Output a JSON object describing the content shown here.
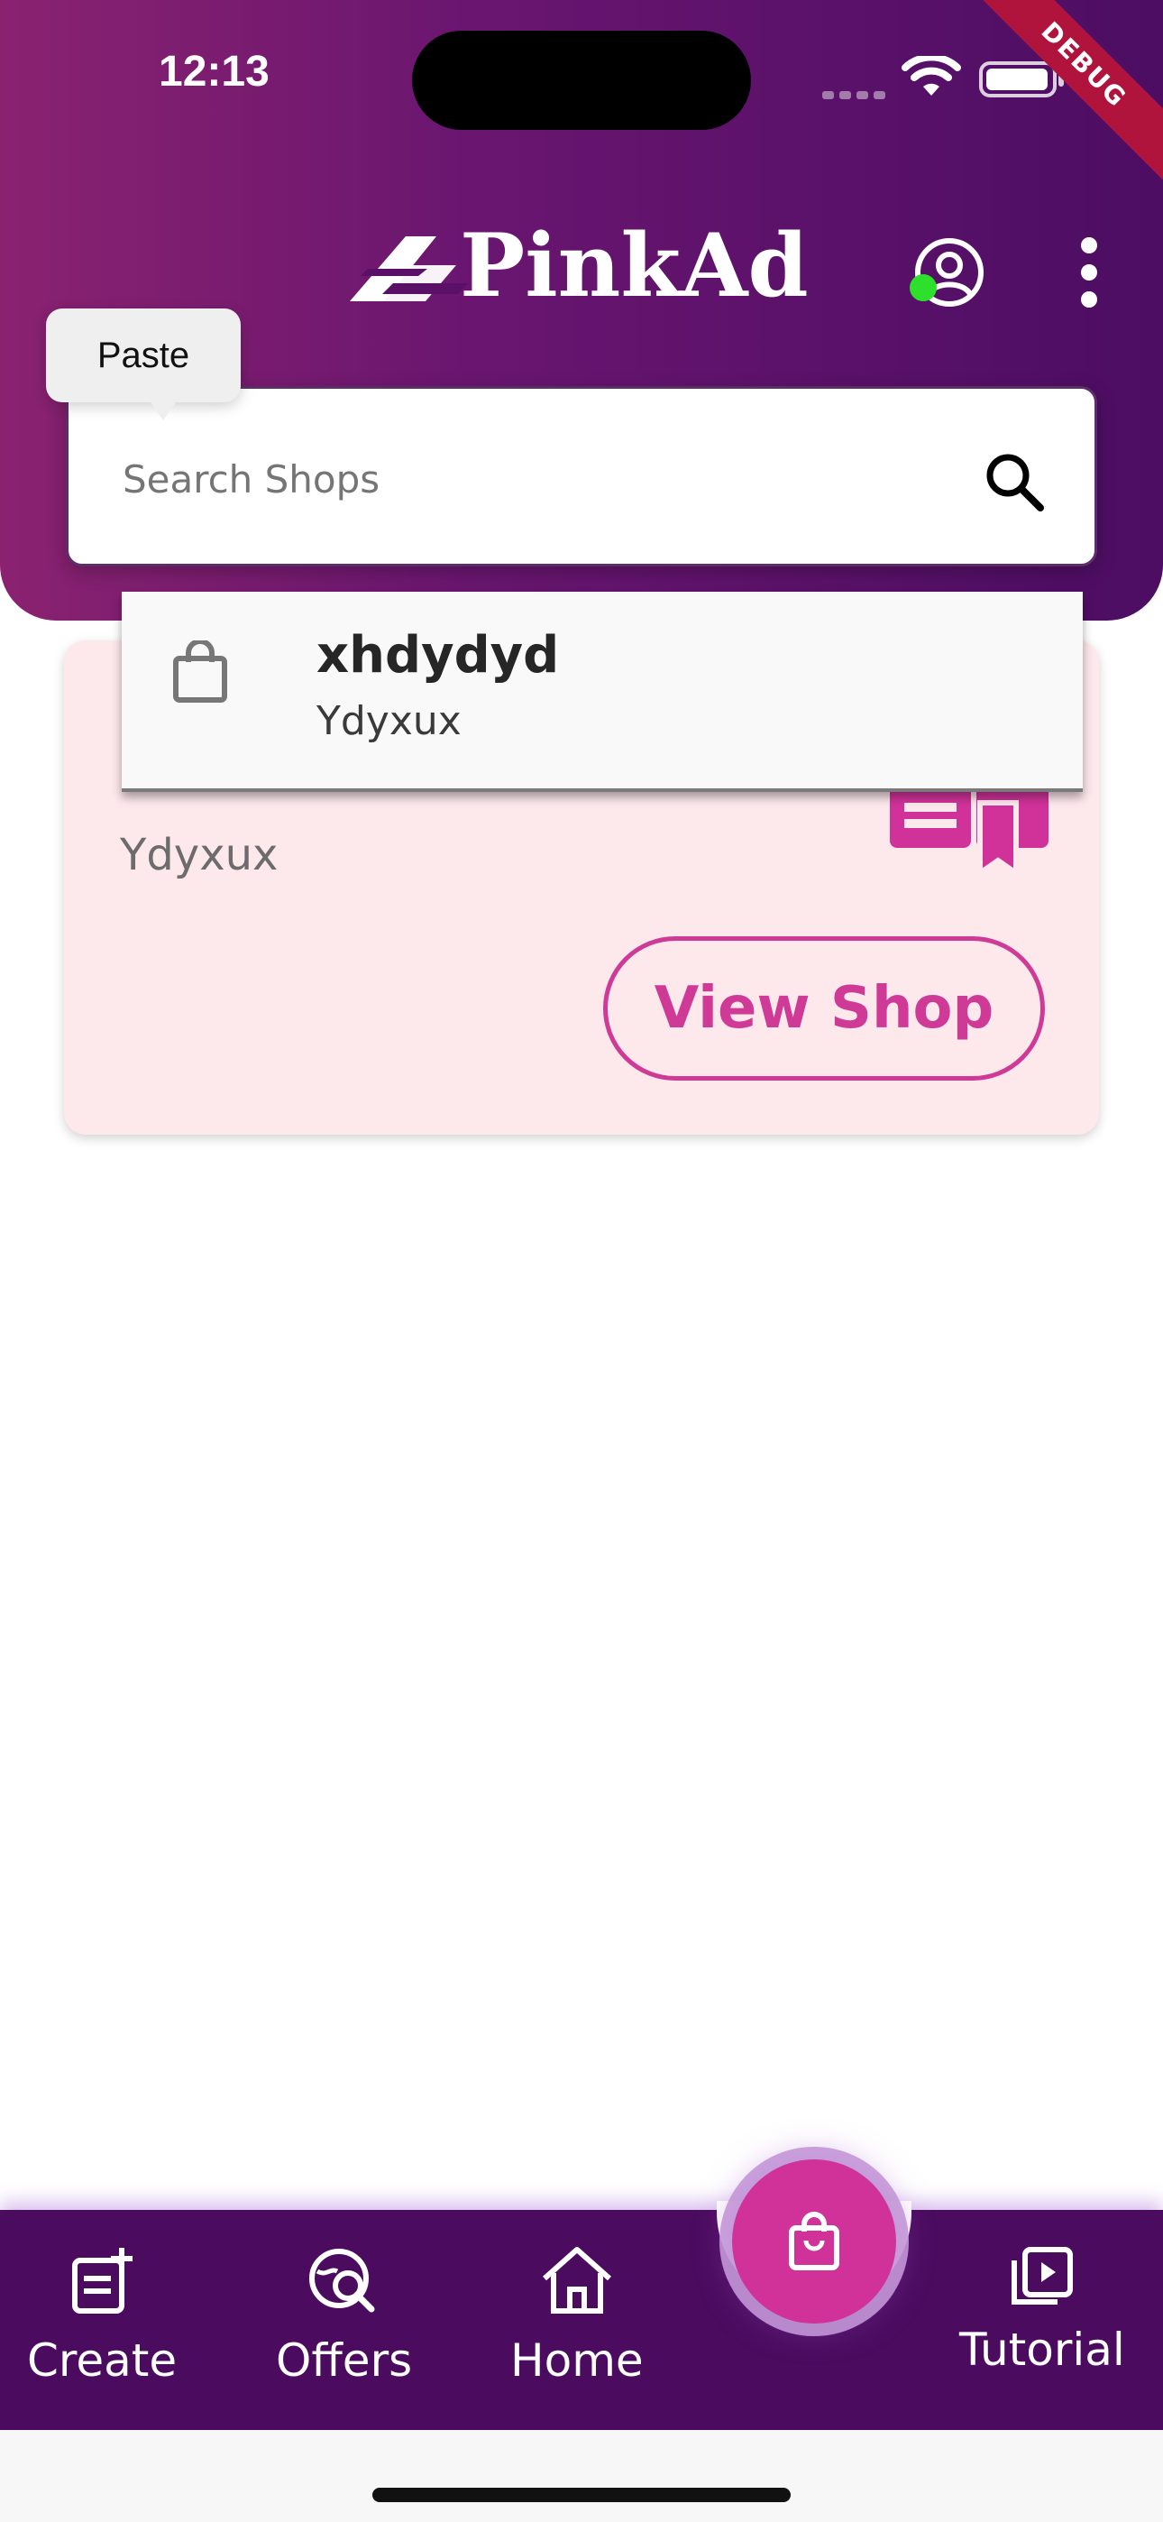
{
  "status_bar": {
    "time": "12:13"
  },
  "debug_label": "DEBUG",
  "header": {
    "logo_text": "PinkAd"
  },
  "search": {
    "placeholder": "Search Shops",
    "value": ""
  },
  "tooltip": {
    "paste_label": "Paste"
  },
  "shop_card": {
    "subtitle": "Ydyxux",
    "button_label": "View Shop"
  },
  "suggestion": {
    "title": "xhdydyd",
    "subtitle": "Ydyxux"
  },
  "bottom_nav": {
    "items": [
      {
        "label": "Create",
        "icon": "create-post-icon"
      },
      {
        "label": "Offers",
        "icon": "offers-search-icon"
      },
      {
        "label": "Home",
        "icon": "home-icon"
      },
      {
        "label": "",
        "icon": "shopping-bag-icon"
      },
      {
        "label": "Tutorial",
        "icon": "tutorial-play-icon"
      }
    ]
  },
  "colors": {
    "accent": "#d0329a",
    "header": "#4c0d63",
    "card_bg": "#fde8ec",
    "online": "#2ce02c"
  }
}
